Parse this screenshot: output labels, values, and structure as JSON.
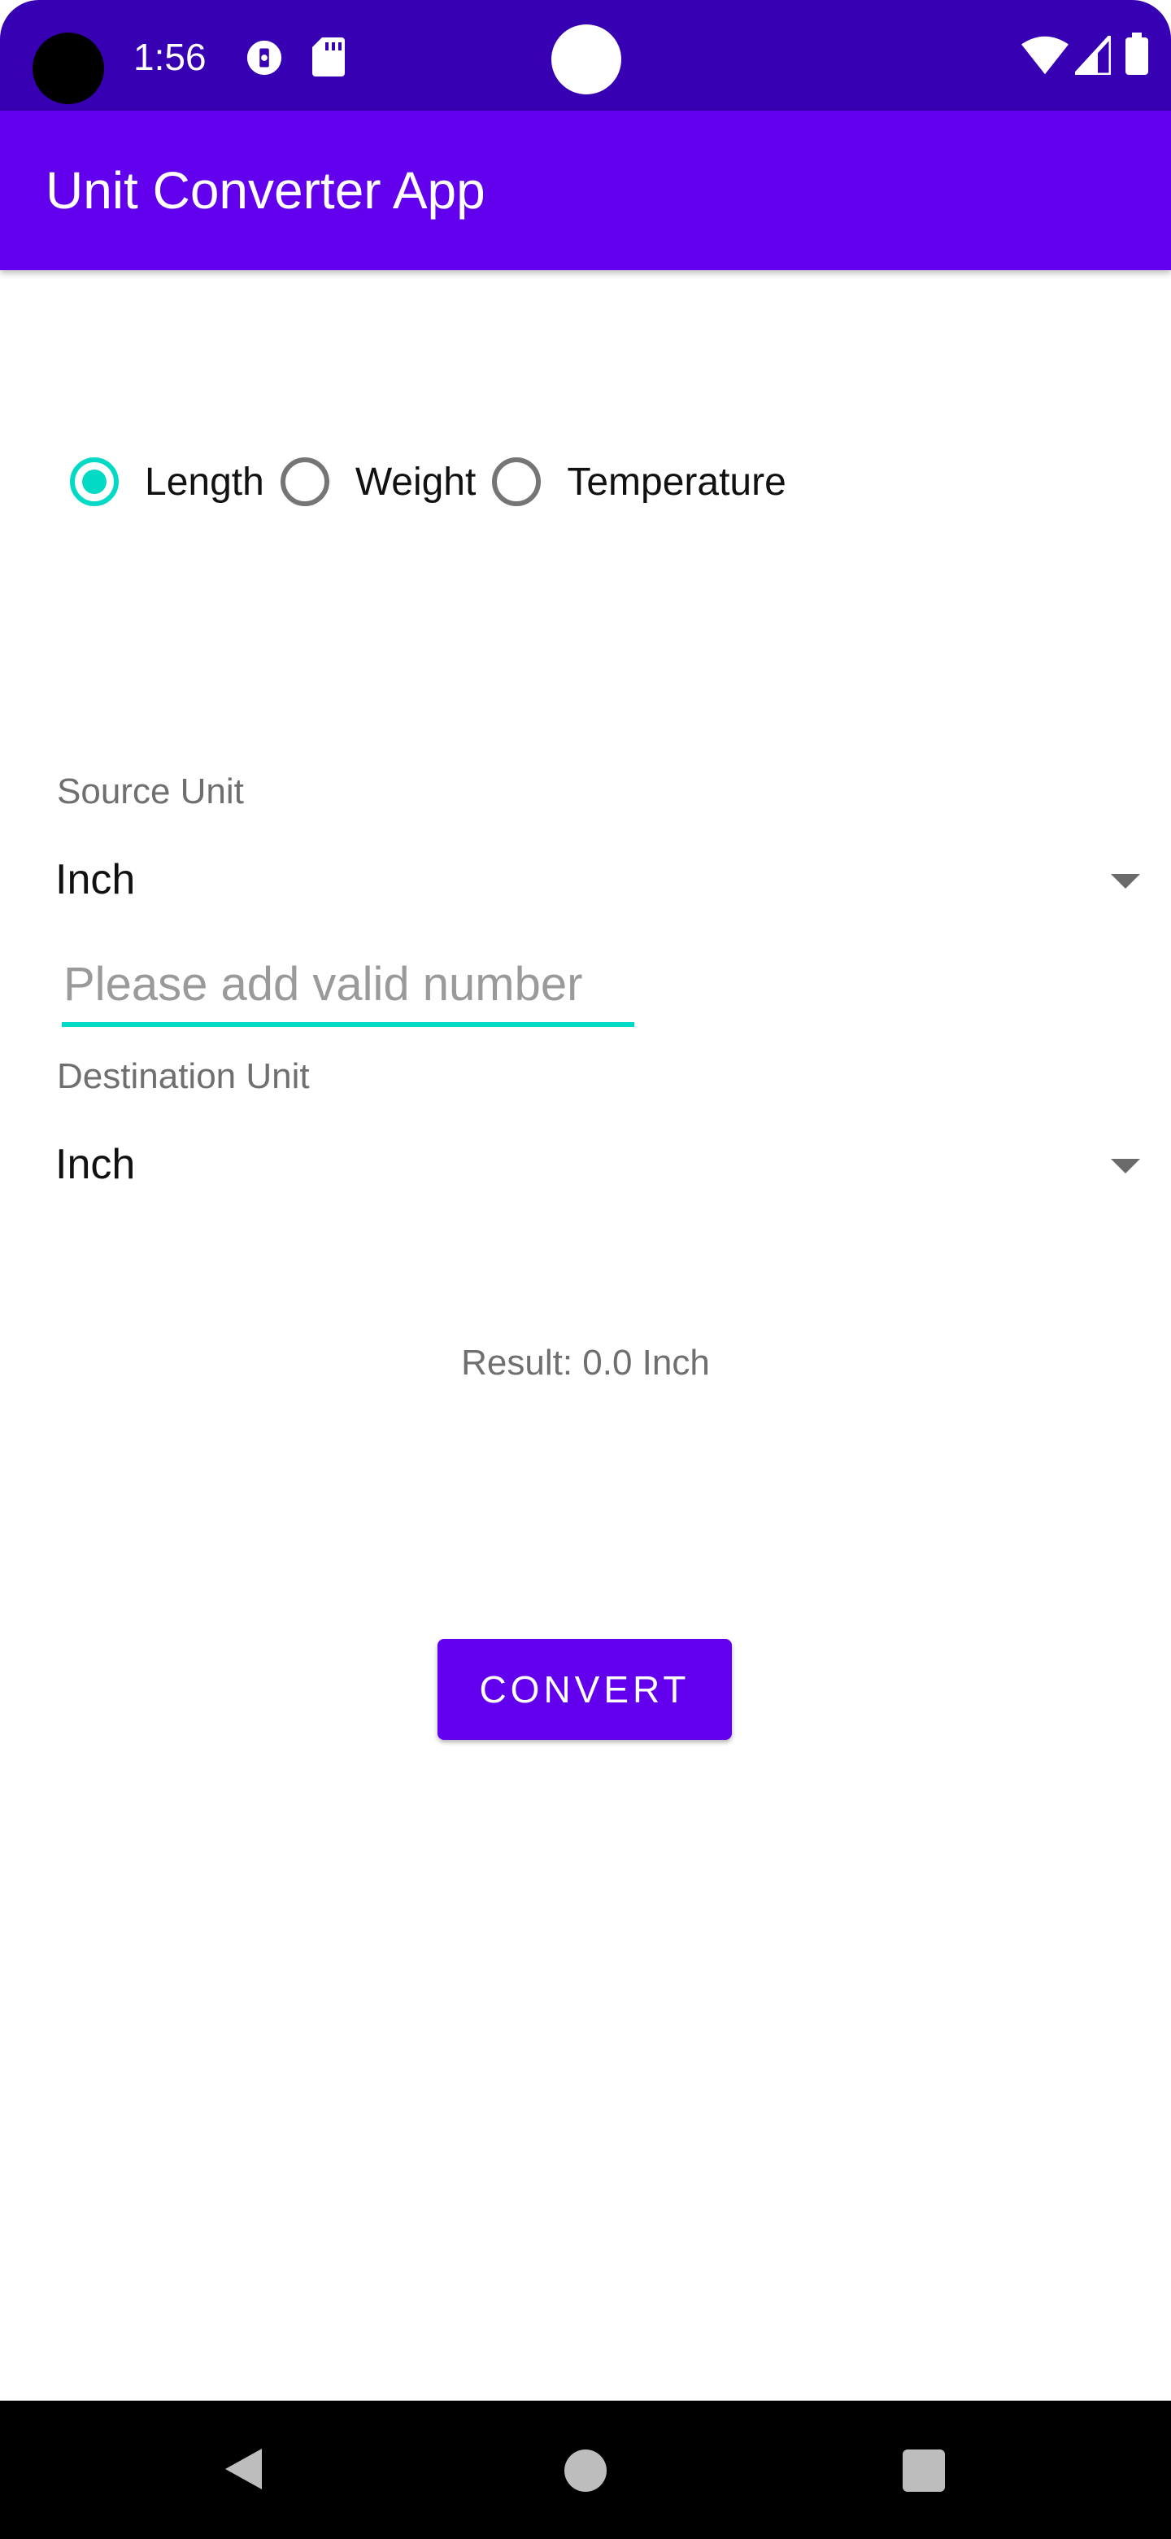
{
  "status_bar": {
    "time": "1:56",
    "icons": [
      "data-saver-icon",
      "sd-card-icon",
      "wifi-icon",
      "signal-icon",
      "battery-icon"
    ],
    "background": "#3700B3"
  },
  "app_bar": {
    "title": "Unit Converter App",
    "background": "#6200EE"
  },
  "conversion_type": {
    "options": [
      {
        "label": "Length",
        "checked": true
      },
      {
        "label": "Weight",
        "checked": false
      },
      {
        "label": "Temperature",
        "checked": false
      }
    ],
    "accent": "#03DAC5"
  },
  "source": {
    "label": "Source Unit",
    "selected": "Inch"
  },
  "input": {
    "value": "",
    "placeholder": "Please add valid number"
  },
  "destination": {
    "label": "Destination Unit",
    "selected": "Inch"
  },
  "result": {
    "text": "Result: 0.0 Inch"
  },
  "actions": {
    "convert_label": "CONVERT"
  },
  "nav_bar": {
    "icons": [
      "back-icon",
      "home-icon",
      "recents-icon"
    ]
  }
}
